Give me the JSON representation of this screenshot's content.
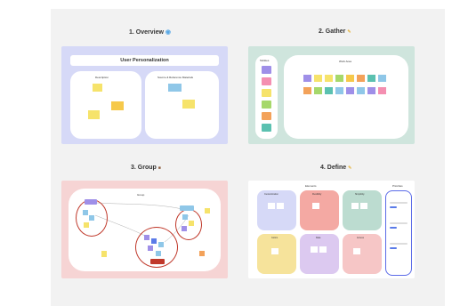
{
  "sections": {
    "overview": {
      "title": "1. Overview",
      "icon": "globe-icon",
      "banner": "User Personalization",
      "left_heading": "Description",
      "right_heading": "Source & Reference Materials"
    },
    "gather": {
      "title": "2. Gather",
      "icon": "pencil-icon",
      "sidebar_heading": "Stickies",
      "area_heading": "Work Area"
    },
    "group": {
      "title": "3. Group",
      "icon": "bag-icon",
      "area_heading": "Group"
    },
    "define": {
      "title": "4. Define",
      "icon": "pencil-icon",
      "themes_heading": "Elements",
      "priorities_heading": "Priorities",
      "theme_labels": [
        "Customization",
        "Flexibility",
        "Simplicity",
        "Colors",
        "Data",
        "Access"
      ]
    }
  },
  "colors": {
    "canvas": "#f2f2f2",
    "overview_bg": "#d6d9f7",
    "gather_bg": "#cfe5dd",
    "group_bg": "#f6d4d4",
    "define_bg": "#ffffff",
    "sticky_yellow": "#f6e36b",
    "sticky_blue": "#8fc7e8",
    "sticky_purple": "#9f8fe8",
    "accent_red": "#c0392b"
  }
}
